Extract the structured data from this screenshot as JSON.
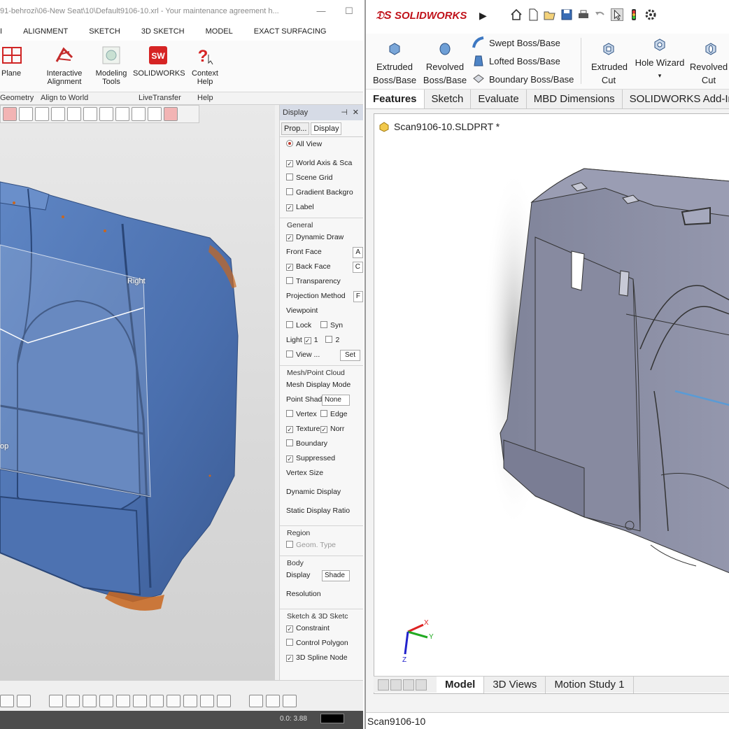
{
  "left_app": {
    "title": "91-behrozi\\06-New Seat\\10\\Default9106-10.xrl - Your maintenance agreement h...",
    "menu_tabs": [
      "ALIGNMENT",
      "SKETCH",
      "3D SKETCH",
      "MODEL",
      "EXACT SURFACING"
    ],
    "ribbon": {
      "plane": "Plane",
      "interactive_alignment": "Interactive Alignment",
      "modeling_tools": "Modeling Tools",
      "solidworks": "SOLIDWORKS",
      "context_help": "Context Help",
      "group_geometry": "Geometry",
      "group_align": "Align to World",
      "group_livetransfer": "LiveTransfer",
      "group_help": "Help"
    },
    "viewport": {
      "label_right": "Right",
      "label_top": "op"
    },
    "display_panel": {
      "title": "Display",
      "tab_properties": "Prop...",
      "tab_display": "Display",
      "all_view": "All View",
      "world_axis": "World Axis & Sca",
      "scene_grid": "Scene Grid",
      "gradient_background": "Gradient Backgro",
      "label": "Label",
      "section_general": "General",
      "dynamic_draw": "Dynamic Draw",
      "front_face": "Front Face",
      "back_face": "Back Face",
      "transparency": "Transparency",
      "projection_method": "Projection Method",
      "viewpoint": "Viewpoint",
      "lock": "Lock",
      "sync": "Syn",
      "light": "Light",
      "light_1": "1",
      "light_2": "2",
      "view_more": "View ...",
      "set": "Set",
      "section_mesh": "Mesh/Point Cloud",
      "mesh_display_mode": "Mesh Display Mode",
      "point_shader": "Point Shader",
      "point_shader_value": "None",
      "vertex": "Vertex",
      "edge": "Edge",
      "texture": "Texture",
      "normal": "Norr",
      "boundary": "Boundary",
      "suppressed": "Suppressed",
      "vertex_size": "Vertex Size",
      "dynamic_display": "Dynamic Display",
      "static_display_ratio": "Static Display Ratio",
      "section_region": "Region",
      "geom_type": "Geom. Type",
      "section_body": "Body",
      "display": "Display",
      "display_value": "Shade",
      "resolution": "Resolution",
      "section_sketch": "Sketch & 3D Sketc",
      "constraint": "Constraint",
      "control_polygon": "Control Polygon",
      "spline_node": "3D Spline Node"
    },
    "statusbar": {
      "coords": "0.0: 3.88"
    }
  },
  "right_app": {
    "brand": "SOLIDWORKS",
    "commands": {
      "extruded_boss": "Extruded Boss/Base",
      "revolved_boss": "Revolved Boss/Base",
      "swept_boss": "Swept Boss/Base",
      "lofted_boss": "Lofted Boss/Base",
      "boundary_boss": "Boundary Boss/Base",
      "extruded_cut": "Extruded Cut",
      "hole_wizard": "Hole Wizard",
      "revolved_cut": "Revolved Cut"
    },
    "cm_tabs": [
      "Features",
      "Sketch",
      "Evaluate",
      "MBD Dimensions",
      "SOLIDWORKS Add-Ins"
    ],
    "document_title": "Scan9106-10.SLDPRT *",
    "triad": {
      "x": "X",
      "y": "Y",
      "z": "Z"
    },
    "bottom_tabs": [
      "Model",
      "3D Views",
      "Motion Study 1"
    ],
    "status_text": "Scan9106-10"
  },
  "colors": {
    "sw_red": "#c0131b",
    "mesh_blue": "#4f77b8",
    "mesh_orange": "#c8661e",
    "part_gray": "#8a8ea6"
  }
}
